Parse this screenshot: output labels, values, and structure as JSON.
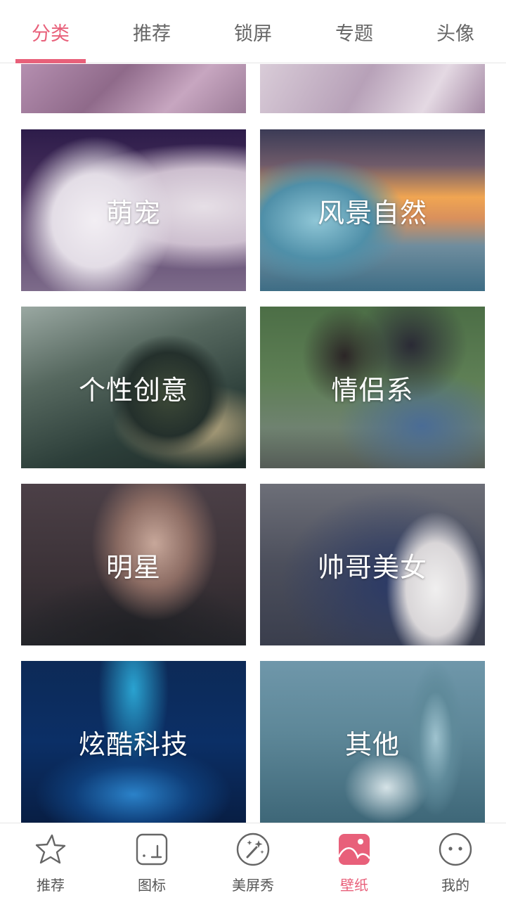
{
  "top_tabs": [
    {
      "label": "分类",
      "active": true
    },
    {
      "label": "推荐",
      "active": false
    },
    {
      "label": "锁屏",
      "active": false
    },
    {
      "label": "专题",
      "active": false
    },
    {
      "label": "头像",
      "active": false
    }
  ],
  "categories": [
    {
      "label": "萌宠"
    },
    {
      "label": "风景自然"
    },
    {
      "label": "个性创意"
    },
    {
      "label": "情侣系"
    },
    {
      "label": "明星"
    },
    {
      "label": "帅哥美女"
    },
    {
      "label": "炫酷科技"
    },
    {
      "label": "其他"
    }
  ],
  "bottom_nav": [
    {
      "label": "推荐",
      "icon": "star-icon",
      "active": false
    },
    {
      "label": "图标",
      "icon": "icon-frame-icon",
      "active": false
    },
    {
      "label": "美屏秀",
      "icon": "magic-wand-icon",
      "active": false
    },
    {
      "label": "壁纸",
      "icon": "wallpaper-icon",
      "active": true
    },
    {
      "label": "我的",
      "icon": "face-icon",
      "active": false
    }
  ],
  "colors": {
    "accent": "#e8607a",
    "inactive_text": "#666666",
    "nav_text": "#555555"
  }
}
